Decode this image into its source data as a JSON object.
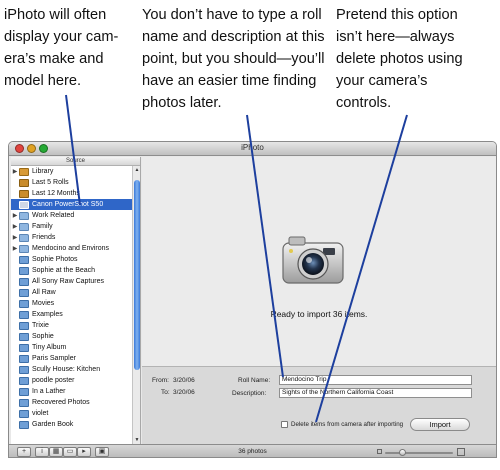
{
  "callouts": {
    "left": [
      "iPhoto will often",
      "display your cam-",
      "era’s make and",
      "model here."
    ],
    "middle": [
      "You don’t have to type a roll",
      "name and description at this",
      "point, but you should—you’ll",
      "have an easier time finding",
      "photos later."
    ],
    "right": [
      "Pretend this option",
      "isn’t here—always",
      "delete photos using",
      "your camera’s",
      "controls."
    ]
  },
  "window": {
    "title": "iPhoto"
  },
  "sidebar": {
    "header": "Source",
    "items": [
      {
        "label": "Library",
        "icon": "library-icon",
        "disclosure": "▶"
      },
      {
        "label": "Last 5 Rolls",
        "icon": "rolls-icon",
        "disclosure": ""
      },
      {
        "label": "Last 12 Months",
        "icon": "rolls-icon",
        "disclosure": ""
      },
      {
        "label": "Canon PowerShot S50",
        "icon": "camera-icon",
        "disclosure": "",
        "selected": true
      },
      {
        "label": "Work Related",
        "icon": "folder-icon",
        "disclosure": "▶"
      },
      {
        "label": "Family",
        "icon": "folder-icon",
        "disclosure": "▶"
      },
      {
        "label": "Friends",
        "icon": "folder-icon",
        "disclosure": "▶"
      },
      {
        "label": "Mendocino and Environs",
        "icon": "folder-icon",
        "disclosure": "▶"
      },
      {
        "label": "Sophie Photos",
        "icon": "album-icon",
        "disclosure": ""
      },
      {
        "label": "Sophie at the Beach",
        "icon": "album-icon",
        "disclosure": ""
      },
      {
        "label": "All Sony Raw Captures",
        "icon": "album-icon",
        "disclosure": ""
      },
      {
        "label": "All Raw",
        "icon": "album-icon",
        "disclosure": ""
      },
      {
        "label": "Movies",
        "icon": "album-icon",
        "disclosure": ""
      },
      {
        "label": "Examples",
        "icon": "album-icon",
        "disclosure": ""
      },
      {
        "label": "Trixie",
        "icon": "album-icon",
        "disclosure": ""
      },
      {
        "label": "Sophie",
        "icon": "album-icon",
        "disclosure": ""
      },
      {
        "label": "Tiny Album",
        "icon": "album-icon",
        "disclosure": ""
      },
      {
        "label": "Paris Sampler",
        "icon": "album-icon",
        "disclosure": ""
      },
      {
        "label": "Scully House: Kitchen",
        "icon": "album-icon",
        "disclosure": ""
      },
      {
        "label": "poodle poster",
        "icon": "album-icon",
        "disclosure": ""
      },
      {
        "label": "In a Lather",
        "icon": "album-icon",
        "disclosure": ""
      },
      {
        "label": "Recovered Photos",
        "icon": "album-icon",
        "disclosure": ""
      },
      {
        "label": "violet",
        "icon": "album-icon",
        "disclosure": ""
      },
      {
        "label": "Garden Book",
        "icon": "album-icon",
        "disclosure": ""
      }
    ]
  },
  "main": {
    "camera_icon": "camera-icon",
    "status": "Ready to import 36 items."
  },
  "import_panel": {
    "from_label": "From:",
    "from_value": "3/20/06",
    "to_label": "To:",
    "to_value": "3/20/06",
    "roll_name_label": "Roll Name:",
    "roll_name_value": "Mendocino Trip",
    "description_label": "Description:",
    "description_value": "Sights of the Northern California Coast",
    "delete_checkbox_label": "Delete items from camera after importing",
    "delete_checked": false,
    "import_button": "Import"
  },
  "bottombar": {
    "add_button": "+",
    "info_button": "i",
    "photo_count": "36 photos"
  },
  "colors": {
    "selection": "#2f66c8",
    "leader_line": "#1d3f9e"
  }
}
